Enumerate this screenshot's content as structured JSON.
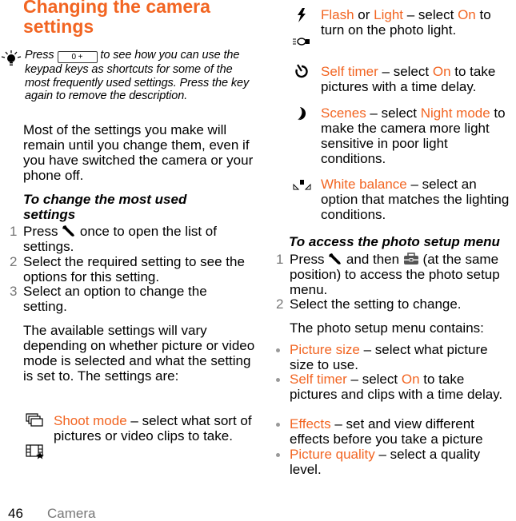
{
  "colors": {
    "accent": "#f26522",
    "step_number": "#777777",
    "section": "#777777"
  },
  "title": "Changing the camera settings",
  "tip": {
    "icon": "lightbulb-icon",
    "before": "Press ",
    "key_label": "0 +",
    "after": " to see how you can use the keypad keys as shortcuts for some of the most frequently used settings. Press the key again to remove the description."
  },
  "intro": "Most of the settings you make will remain until you change them, even if you have switched the camera or your phone off.",
  "change_settings": {
    "heading": "To change the most used settings",
    "steps": [
      {
        "num": "1",
        "before": "Press ",
        "icon": "wrench-icon",
        "after": " once to open the list of settings."
      },
      {
        "num": "2",
        "text": "Select the required setting to see the options for this setting."
      },
      {
        "num": "3",
        "text": "Select an option to change the setting."
      }
    ]
  },
  "available_text": "The available settings will vary depending on whether picture or video mode is selected and what the setting is set to. The settings are:",
  "settings": [
    {
      "icons": [
        "shoot-mode-icon",
        "video-mode-icon"
      ],
      "name": "Shoot mode",
      "desc": " – select what sort of pictures or video clips to take."
    },
    {
      "icons": [
        "flash-icon",
        "photo-light-icon"
      ],
      "name": "Flash",
      "joiner": " or ",
      "name2": "Light",
      "desc_before": " – select ",
      "value": "On",
      "desc_after": " to turn on the photo light."
    },
    {
      "icons": [
        "self-timer-icon"
      ],
      "name": "Self timer",
      "desc_before": " – select ",
      "value": "On",
      "desc_after": " to take pictures with a time delay."
    },
    {
      "icons": [
        "night-mode-icon"
      ],
      "name": "Scenes",
      "desc_before": " – select ",
      "value": "Night mode",
      "desc_after": " to make the camera more light sensitive in poor light conditions."
    },
    {
      "icons": [
        "white-balance-icon"
      ],
      "name": "White balance",
      "desc": " – select an option that matches the lighting conditions."
    }
  ],
  "photo_setup": {
    "heading": "To access the photo setup menu",
    "steps": [
      {
        "num": "1",
        "before": "Press ",
        "icon1": "wrench-icon",
        "middle": " and then ",
        "icon2": "toolbox-icon",
        "after": " (at the same position) to access the photo setup menu."
      },
      {
        "num": "2",
        "text": "Select the setting to change."
      }
    ],
    "contains_text": "The photo setup menu contains:",
    "items": [
      {
        "name": "Picture size",
        "desc": " – select what picture size to use."
      },
      {
        "name": "Self timer",
        "desc_before": " – select ",
        "value": "On",
        "desc_after": " to take pictures and clips with a time delay."
      },
      {
        "name": "Effects",
        "desc": " – set and view different effects before you take a picture"
      },
      {
        "name": "Picture quality",
        "desc": " – select a quality level."
      }
    ]
  },
  "footer": {
    "page_number": "46",
    "section": "Camera"
  }
}
